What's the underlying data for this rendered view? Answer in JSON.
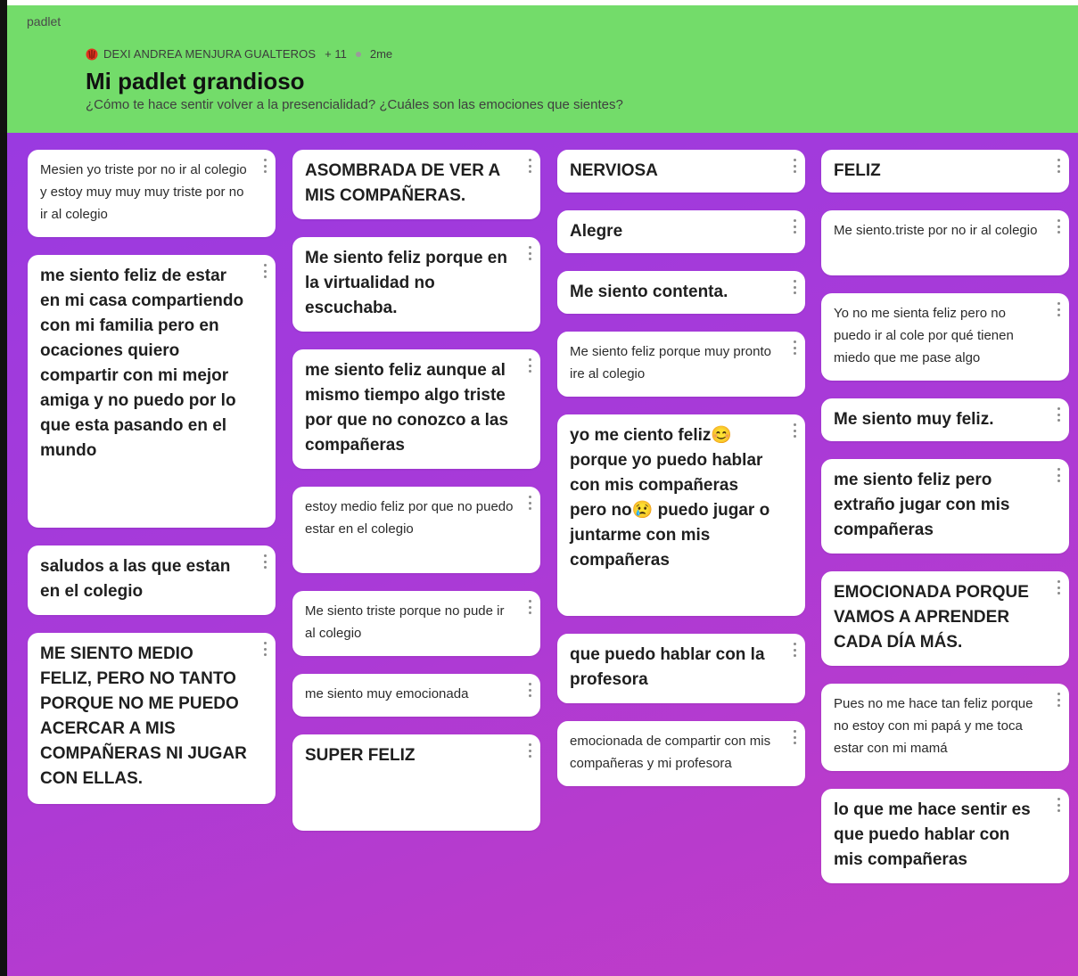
{
  "app": {
    "brand": "padlet"
  },
  "header": {
    "author": "DEXI ANDREA MENJURA GUALTEROS",
    "contributors": "+ 11",
    "time": "2me",
    "title": "Mi padlet grandioso",
    "subtitle": "¿Cómo te hace sentir volver a la presencialidad? ¿Cuáles son las emociones que sientes?"
  },
  "columns": [
    {
      "posts": [
        {
          "text": "Mesien yo triste por no ir al colegio y estoy muy muy muy triste por no ir al colegio",
          "style": "sm",
          "height": 98
        },
        {
          "text": "me siento feliz de estar en mi casa compartiendo con mi familia pero en ocaciones quiero compartir con mi mejor amiga y no puedo por lo que esta pasando en el mundo",
          "style": "lg",
          "height": 306
        },
        {
          "text": "saludos a las que estan en el colegio",
          "style": "lg",
          "height": 78
        },
        {
          "text": "ME SIENTO MEDIO FELIZ, PERO NO TANTO PORQUE NO ME PUEDO ACERCAR A MIS COMPAÑERAS NI JUGAR CON ELLAS.",
          "style": "lg",
          "height": 192
        }
      ]
    },
    {
      "posts": [
        {
          "text": "ASOMBRADA DE VER A MIS COMPAÑERAS.",
          "style": "lg",
          "height": 78
        },
        {
          "text": "Me siento feliz porque en la virtualidad no escuchaba.",
          "style": "lg",
          "height": 106
        },
        {
          "text": "me siento feliz aunque al mismo tiempo algo triste por que no conozco a las compañeras",
          "style": "lg",
          "height": 134
        },
        {
          "text": "estoy medio feliz por que no puedo estar en el colegio",
          "style": "sm",
          "height": 97
        },
        {
          "text": "Me siento triste porque no pude ir al colegio",
          "style": "sm",
          "height": 73
        },
        {
          "text": "me siento muy emocionada",
          "style": "sm",
          "height": 48
        },
        {
          "text": "SUPER FELIZ",
          "style": "lg",
          "height": 108
        }
      ]
    },
    {
      "posts": [
        {
          "text": "NERVIOSA",
          "style": "lg",
          "height": 48
        },
        {
          "text": "Alegre",
          "style": "lg",
          "height": 48
        },
        {
          "text": "Me siento contenta.",
          "style": "lg",
          "height": 48
        },
        {
          "text": "Me siento feliz porque muy pronto ire al colegio",
          "style": "sm",
          "height": 73
        },
        {
          "text": "yo me ciento feliz😊 porque yo puedo hablar con mis compañeras pero no😢 puedo jugar o juntarme con mis compañeras",
          "style": "lg",
          "height": 226
        },
        {
          "text": "que puedo hablar con la profesora",
          "style": "lg",
          "height": 78
        },
        {
          "text": "emocionada de compartir con mis compañeras y mi profesora",
          "style": "sm",
          "height": 73
        }
      ]
    },
    {
      "posts": [
        {
          "text": "FELIZ",
          "style": "lg",
          "height": 48
        },
        {
          "text": "Me siento.triste por no ir al colegio",
          "style": "sm",
          "height": 73
        },
        {
          "text": "Yo no me sienta feliz pero no puedo ir al cole por qué tienen miedo que me pase algo",
          "style": "sm",
          "height": 98
        },
        {
          "text": "Me siento muy feliz.",
          "style": "lg",
          "height": 48
        },
        {
          "text": "me siento feliz pero extraño jugar con mis compañeras",
          "style": "lg",
          "height": 106
        },
        {
          "text": "EMOCIONADA PORQUE VAMOS A APRENDER CADA DÍA MÁS.",
          "style": "lg",
          "height": 106
        },
        {
          "text": "Pues no me hace tan feliz porque no estoy con mi papá y me toca estar con mi mamá",
          "style": "sm",
          "height": 98
        },
        {
          "text": "lo que me hace sentir es que puedo hablar con mis compañeras",
          "style": "lg",
          "height": 106
        }
      ]
    }
  ]
}
